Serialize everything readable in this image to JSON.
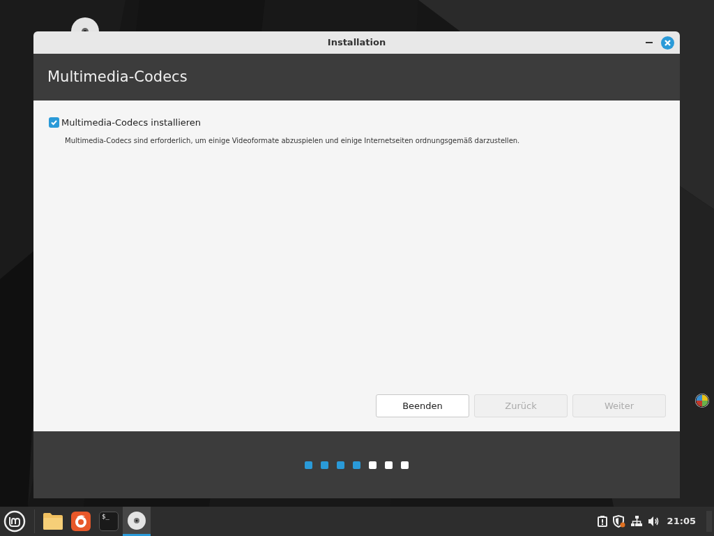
{
  "window": {
    "title": "Installation"
  },
  "header": {
    "title": "Multimedia-Codecs"
  },
  "option": {
    "label": "Multimedia-Codecs installieren",
    "checked": true,
    "description": "Multimedia-Codecs sind erforderlich, um einige Videoformate abzuspielen und einige Internetseiten ordnungsgemäß darzustellen."
  },
  "buttons": [
    {
      "label": "Beenden",
      "disabled": false
    },
    {
      "label": "Zurück",
      "disabled": true
    },
    {
      "label": "Weiter",
      "disabled": true
    }
  ],
  "steps": [
    {
      "done": true
    },
    {
      "done": true
    },
    {
      "done": true
    },
    {
      "done": true
    },
    {
      "done": false
    },
    {
      "done": false
    },
    {
      "done": false
    }
  ],
  "taskbar": {
    "apps": [
      {
        "kind": "files",
        "selected": false
      },
      {
        "kind": "browser",
        "selected": false
      },
      {
        "kind": "terminal",
        "selected": false,
        "prompt": "$_"
      },
      {
        "kind": "disc",
        "selected": true
      }
    ],
    "tray": [
      {
        "kind": "clipboard"
      },
      {
        "kind": "shield"
      },
      {
        "kind": "network"
      },
      {
        "kind": "volume"
      }
    ],
    "clock": "21:05"
  }
}
